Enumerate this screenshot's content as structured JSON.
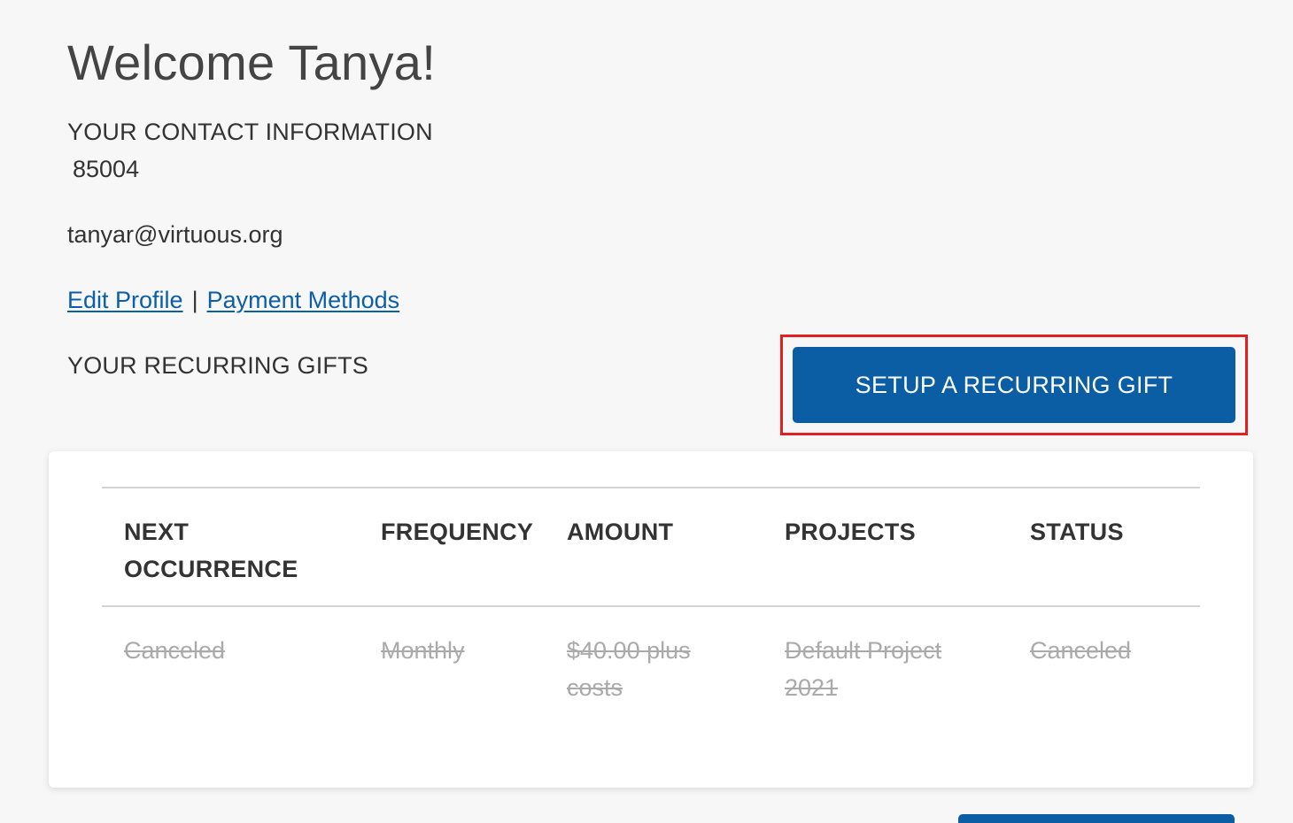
{
  "welcome": {
    "title": "Welcome Tanya!"
  },
  "contact": {
    "heading": "YOUR CONTACT INFORMATION",
    "zip": "85004",
    "email": "tanyar@virtuous.org"
  },
  "links": {
    "edit_profile": "Edit Profile",
    "separator": "|",
    "payment_methods": "Payment Methods"
  },
  "recurring": {
    "heading": "YOUR RECURRING GIFTS",
    "setup_button": "SETUP A RECURRING GIFT"
  },
  "table": {
    "headers": {
      "next_occurrence": "NEXT OCCURRENCE",
      "frequency": "FREQUENCY",
      "amount": "AMOUNT",
      "projects": "PROJECTS",
      "status": "STATUS"
    },
    "rows": [
      {
        "next_occurrence": "Canceled",
        "frequency": "Monthly",
        "amount": "$40.00 plus costs",
        "projects": "Default Project 2021",
        "status": "Canceled"
      }
    ]
  },
  "colors": {
    "accent": "#0b5ea3",
    "link": "#0b5ea8",
    "highlight": "#e32020",
    "canceled_text": "#aaaaaa"
  }
}
